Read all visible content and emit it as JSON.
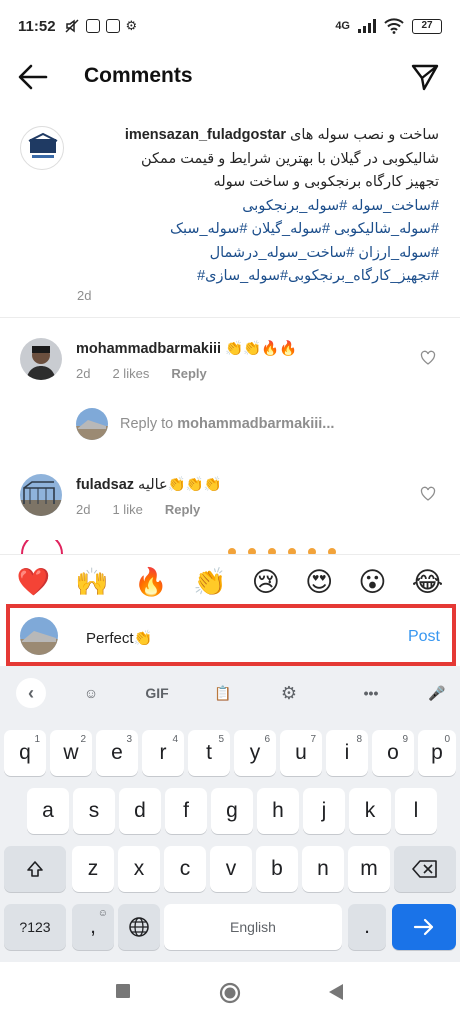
{
  "status_bar": {
    "time": "11:52",
    "network": "4G",
    "battery": "27"
  },
  "header": {
    "title": "Comments",
    "back_icon": "arrow-left-icon",
    "send_icon": "paper-plane-icon"
  },
  "caption": {
    "username": "imensazan_fuladgostar",
    "lines": [
      "ساخت و نصب سوله های",
      "شالیکوبی در گیلان با بهترین شرایط و قیمت ممکن",
      "تجهیز کارگاه برنجکوبی و ساخت سوله",
      "#ساخت_سوله #سوله_برنجکوبی",
      "#سوله_شالیکوبی #سوله_گیلان #سوله_سبک",
      "#سوله_ارزان #ساخت_سوله_درشمال",
      "#تجهیز_کارگاه_برنجکوبی#سوله_سازی#"
    ],
    "time": "2d"
  },
  "comments": [
    {
      "username": "mohammadbarmakiii",
      "text": "👏👏🔥🔥",
      "time": "2d",
      "likes": "2 likes",
      "reply": "Reply"
    },
    {
      "username": "fuladsaz",
      "text": "عالیه👏👏👏",
      "time": "2d",
      "likes": "1 like",
      "reply": "Reply"
    }
  ],
  "reply_prompt": {
    "prefix": "Reply to",
    "target": "mohammadbarmakiii..."
  },
  "emoji_bar": [
    "❤️",
    "🙌",
    "🔥",
    "👏",
    "😢",
    "😍",
    "😮",
    "😂"
  ],
  "input": {
    "value": "Perfect👏",
    "post_label": "Post"
  },
  "keyboard": {
    "toolbar": [
      "‹",
      "☺",
      "GIF",
      "📋",
      "⚙",
      "•••",
      "🎤"
    ],
    "row1": [
      [
        "q",
        "1"
      ],
      [
        "w",
        "2"
      ],
      [
        "e",
        "3"
      ],
      [
        "r",
        "4"
      ],
      [
        "t",
        "5"
      ],
      [
        "y",
        "6"
      ],
      [
        "u",
        "7"
      ],
      [
        "i",
        "8"
      ],
      [
        "o",
        "9"
      ],
      [
        "p",
        "0"
      ]
    ],
    "row2": [
      "a",
      "s",
      "d",
      "f",
      "g",
      "h",
      "j",
      "k",
      "l"
    ],
    "row3": [
      "z",
      "x",
      "c",
      "v",
      "b",
      "n",
      "m"
    ],
    "sym_label": "?123",
    "comma": ",",
    "space_label": "English",
    "period": "."
  },
  "colors": {
    "accent": "#3897f0",
    "highlight": "#e53935",
    "hashtag": "#1d4f8c",
    "enter_key": "#1a73e8"
  }
}
